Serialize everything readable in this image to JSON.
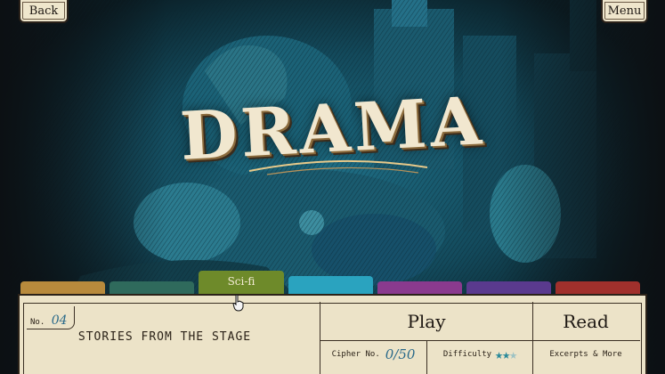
{
  "nav": {
    "back_label": "Back",
    "menu_label": "Menu"
  },
  "title": "DRAMA",
  "tabs": [
    {
      "label": "",
      "color": "#b88a3c"
    },
    {
      "label": "",
      "color": "#2f6a5c"
    },
    {
      "label": "Sci-fi",
      "color": "#6e8a2a",
      "active": true
    },
    {
      "label": "",
      "color": "#2aa3bf"
    },
    {
      "label": "",
      "color": "#8a3a8e"
    },
    {
      "label": "",
      "color": "#5a3a8e"
    },
    {
      "label": "",
      "color": "#a0302c"
    }
  ],
  "panel": {
    "number_prefix": "No.",
    "number_value": "04",
    "story_title": "STORIES FROM THE STAGE",
    "play_label": "Play",
    "read_label": "Read",
    "cipher_prefix": "Cipher No.",
    "cipher_value": "0/50",
    "difficulty_label": "Difficulty",
    "difficulty_stars": 2,
    "difficulty_max": 3,
    "excerpts_label": "Excerpts & More"
  },
  "colors": {
    "accent_teal": "#2a8a9a",
    "paper": "#ece3c8",
    "ink": "#2b2218"
  }
}
